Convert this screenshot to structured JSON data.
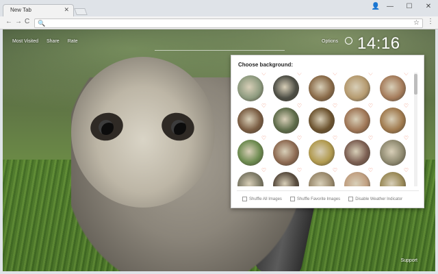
{
  "browser": {
    "tab_title": "New Tab",
    "tab_close": "✕",
    "win_profile": "👤",
    "win_min": "—",
    "win_max": "☐",
    "win_close": "✕",
    "back": "←",
    "forward": "→",
    "reload": "C",
    "omnibox_value": "",
    "bookmark_star": "☆",
    "menu": "⋮"
  },
  "page": {
    "top_links": [
      "Most Visited",
      "Share",
      "Rate"
    ],
    "search_placeholder": "",
    "options": "Options",
    "clock": "14:16",
    "support": "Support"
  },
  "panel": {
    "title": "Choose background:",
    "heart": "♡",
    "thumbnail_colors": [
      [
        "#8e9b7f",
        "#4d4e45",
        "#8a6b49",
        "#b59a6f",
        "#a57c5b"
      ],
      [
        "#7a5d43",
        "#5e6c4a",
        "#6d5430",
        "#9f7656",
        "#a07a4e"
      ],
      [
        "#6c8a4f",
        "#8e6b52",
        "#b19a4f",
        "#7c5f52",
        "#8f8a70"
      ],
      [
        "#7d7a66",
        "#5a4d3f",
        "#9a8a6d",
        "#c09f80",
        "#9a8a58"
      ]
    ],
    "checkboxes": [
      "Shuffle All Images",
      "Shuffle Favorite Images",
      "Disable Weather Indicator"
    ]
  }
}
